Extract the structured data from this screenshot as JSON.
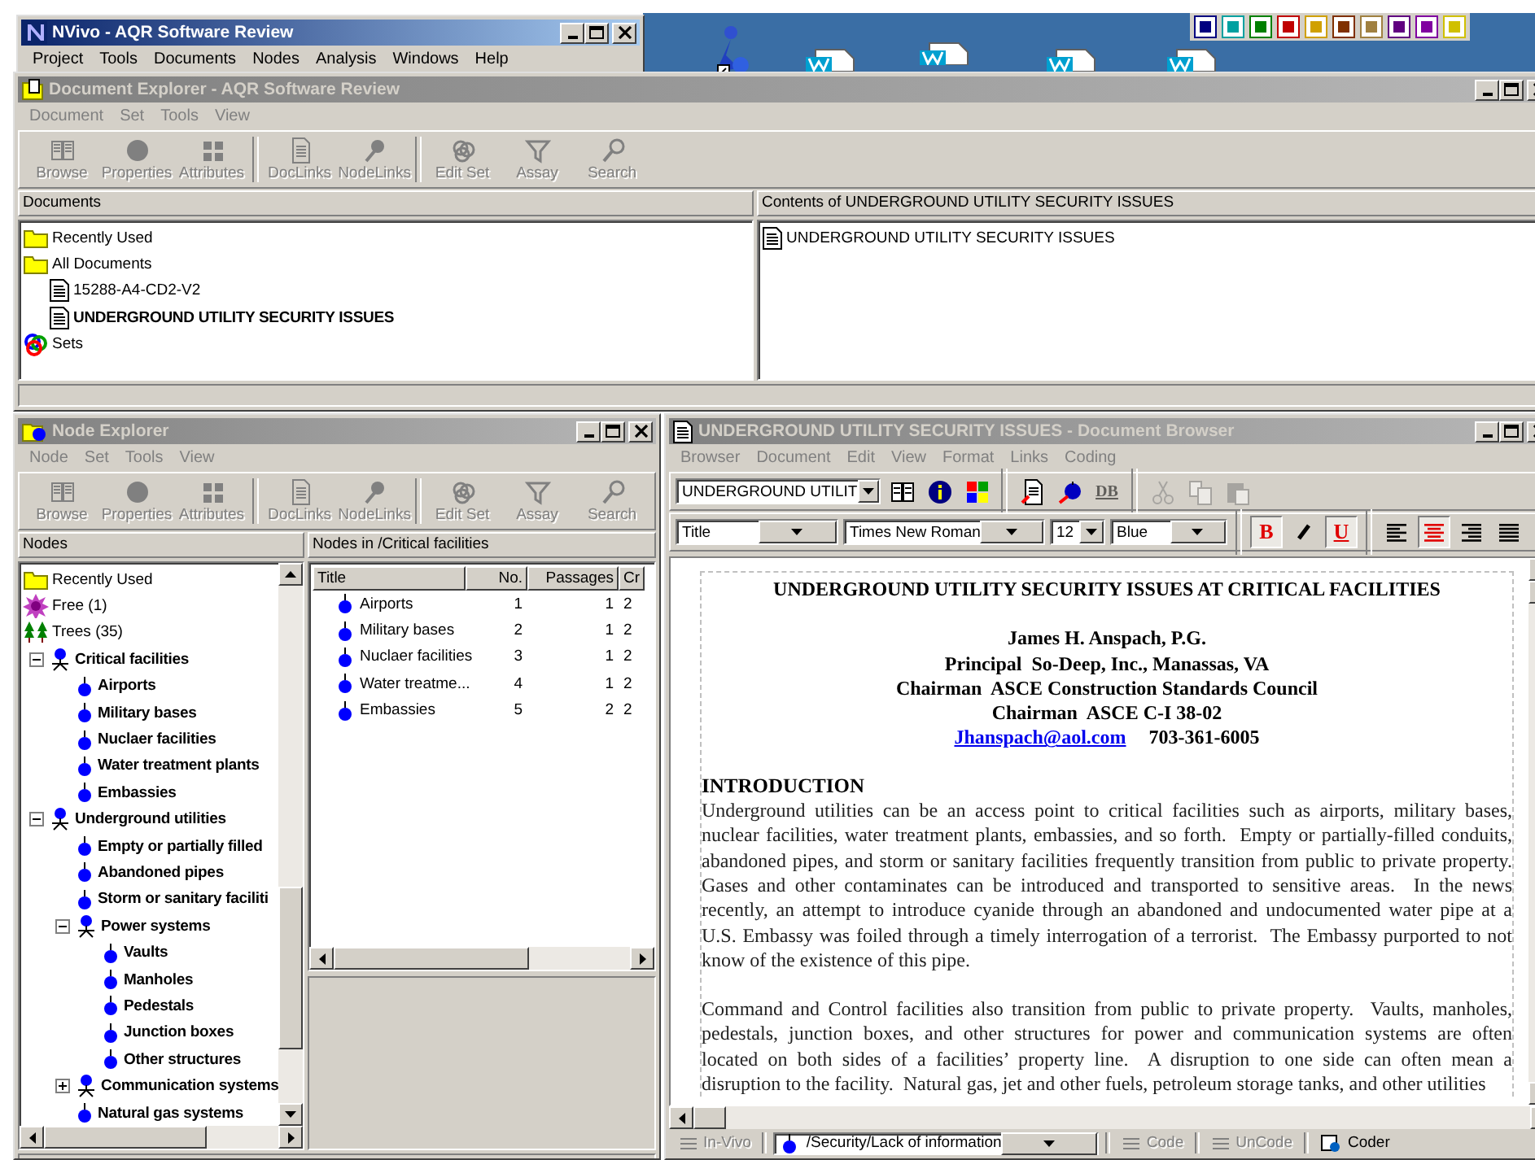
{
  "main_window": {
    "title": "NVivo - AQR Software Review",
    "active": true,
    "menu": [
      "Project",
      "Tools",
      "Documents",
      "Nodes",
      "Analysis",
      "Windows",
      "Help"
    ]
  },
  "document_explorer": {
    "title": "Document Explorer - AQR Software Review",
    "active": false,
    "menu": [
      "Document",
      "Set",
      "Tools",
      "View"
    ],
    "toolbar": [
      [
        {
          "label": "Browse",
          "kind": "book",
          "disabled": true
        },
        {
          "label": "Properties",
          "kind": "circle",
          "disabled": true
        },
        {
          "label": "Attributes",
          "kind": "grid",
          "disabled": true
        }
      ],
      [
        {
          "label": "DocLinks",
          "kind": "doclink",
          "disabled": true
        },
        {
          "label": "NodeLinks",
          "kind": "pin",
          "disabled": true
        }
      ],
      [
        {
          "label": "Edit Set",
          "kind": "sets",
          "disabled": true
        },
        {
          "label": "Assay",
          "kind": "funnel",
          "disabled": true
        },
        {
          "label": "Search",
          "kind": "search",
          "disabled": true
        }
      ]
    ],
    "documents_pane": {
      "header": "Documents",
      "items": [
        {
          "label": "Recently Used",
          "kind": "folder"
        },
        {
          "label": "All Documents",
          "kind": "folder",
          "children": [
            {
              "label": "15288-A4-CD2-V2",
              "kind": "document",
              "open": false
            },
            {
              "label": "UNDERGROUND UTILITY SECURITY ISSUES",
              "kind": "document",
              "open": true
            }
          ]
        },
        {
          "label": "Sets",
          "kind": "sets"
        }
      ]
    },
    "contents_pane": {
      "header": "Contents of UNDERGROUND UTILITY SECURITY ISSUES",
      "items": [
        {
          "label": "UNDERGROUND UTILITY SECURITY ISSUES",
          "kind": "document"
        }
      ]
    }
  },
  "node_explorer": {
    "title": "Node Explorer",
    "active": false,
    "menu": [
      "Node",
      "Set",
      "Tools",
      "View"
    ],
    "toolbar": [
      [
        {
          "label": "Browse",
          "kind": "book",
          "disabled": true
        },
        {
          "label": "Properties",
          "kind": "circle",
          "disabled": true
        },
        {
          "label": "Attributes",
          "kind": "grid",
          "disabled": true
        }
      ],
      [
        {
          "label": "DocLinks",
          "kind": "doclink",
          "disabled": true
        },
        {
          "label": "NodeLinks",
          "kind": "pin",
          "disabled": true
        }
      ],
      [
        {
          "label": "Edit Set",
          "kind": "sets",
          "disabled": true
        },
        {
          "label": "Assay",
          "kind": "funnel",
          "disabled": true
        },
        {
          "label": "Search",
          "kind": "search",
          "disabled": true
        }
      ]
    ],
    "nodes_pane": {
      "header": "Nodes",
      "items": [
        {
          "label": "Recently Used",
          "kind": "folder"
        },
        {
          "label": "Free (1)",
          "kind": "free"
        },
        {
          "label": "Trees (35)",
          "kind": "trees",
          "children": [
            {
              "label": "Critical facilities",
              "kind": "tree-node",
              "expanded": true,
              "children": [
                {
                  "label": "Airports",
                  "kind": "node"
                },
                {
                  "label": "Military bases",
                  "kind": "node"
                },
                {
                  "label": "Nuclaer facilities",
                  "kind": "node"
                },
                {
                  "label": "Water treatment plants",
                  "kind": "node"
                },
                {
                  "label": "Embassies",
                  "kind": "node"
                }
              ]
            },
            {
              "label": "Underground utilities",
              "kind": "tree-node",
              "expanded": true,
              "children": [
                {
                  "label": "Empty or partially filled",
                  "kind": "node"
                },
                {
                  "label": "Abandoned pipes",
                  "kind": "node"
                },
                {
                  "label": "Storm or sanitary faciliti",
                  "kind": "node"
                },
                {
                  "label": "Power systems",
                  "kind": "tree-node",
                  "expanded": true,
                  "children": [
                    {
                      "label": "Vaults",
                      "kind": "node"
                    },
                    {
                      "label": "Manholes",
                      "kind": "node"
                    },
                    {
                      "label": "Pedestals",
                      "kind": "node"
                    },
                    {
                      "label": "Junction boxes",
                      "kind": "node"
                    },
                    {
                      "label": "Other structures",
                      "kind": "node"
                    }
                  ]
                },
                {
                  "label": "Communication systems",
                  "kind": "tree-node",
                  "expanded": false
                },
                {
                  "label": "Natural gas systems",
                  "kind": "node"
                }
              ]
            }
          ]
        }
      ]
    },
    "list_pane": {
      "header": "Nodes in /Critical facilities",
      "columns": [
        "Title",
        "No.",
        "Passages",
        "Cr"
      ],
      "rows": [
        [
          "Airports",
          "1",
          "1",
          "2"
        ],
        [
          "Military bases",
          "2",
          "1",
          "2"
        ],
        [
          "Nuclaer facilities",
          "3",
          "1",
          "2"
        ],
        [
          "Water treatme...",
          "4",
          "1",
          "2"
        ],
        [
          "Embassies",
          "5",
          "2",
          "2"
        ]
      ]
    }
  },
  "document_browser": {
    "title": "UNDERGROUND UTILITY SECURITY ISSUES - Document Browser",
    "active": false,
    "menu": [
      "Browser",
      "Document",
      "Edit",
      "View",
      "Format",
      "Links",
      "Coding"
    ],
    "document_combo": "UNDERGROUND UTILIT",
    "tools": [
      {
        "kind": "book",
        "disabled": false
      },
      {
        "kind": "info",
        "disabled": false
      },
      {
        "kind": "palette",
        "disabled": false
      },
      {
        "kind": "doclink",
        "disabled": false
      },
      {
        "kind": "nodelink",
        "disabled": false
      },
      {
        "kind": "database",
        "label": "DB",
        "disabled": true
      },
      {
        "kind": "cut",
        "disabled": true
      },
      {
        "kind": "copy",
        "disabled": true
      },
      {
        "kind": "paste",
        "disabled": true
      }
    ],
    "format": {
      "style": "Title",
      "font": "Times New Roman",
      "size": "12",
      "text_colour": "Blue",
      "buttons": [
        {
          "kind": "bold",
          "label": "B",
          "pressed": true
        },
        {
          "kind": "italic",
          "pressed": false
        },
        {
          "kind": "underline",
          "label": "U",
          "pressed": true
        },
        {
          "kind": "align-left",
          "pressed": false
        },
        {
          "kind": "align-center",
          "pressed": true
        },
        {
          "kind": "align-right",
          "pressed": false
        },
        {
          "kind": "justify",
          "pressed": false
        }
      ]
    },
    "document": [
      {
        "kind": "title",
        "text": "UNDERGROUND UTILITY SECURITY ISSUES AT CRITICAL FACILITIES"
      },
      {
        "kind": "author",
        "lines": [
          "James H. Anspach, P.G.",
          "Principal  So-Deep, Inc., Manassas, VA",
          "Chairman  ASCE Construction Standards Council",
          "Chairman  ASCE C-I 38-02"
        ]
      },
      {
        "kind": "contact",
        "link": "Jhanspach@aol.com",
        "text": "703-361-6005"
      },
      {
        "kind": "heading",
        "text": "INTRODUCTION"
      },
      {
        "kind": "paragraph",
        "lines": [
          "Underground utilities can be an access point to critical facilities such as airports, military bases,",
          "nuclear facilities, water treatment plants, embassies, and so forth.  Empty or partially-filled conduits,",
          "abandoned pipes, and storm or sanitary facilities frequently transition from public to private property.",
          "Gases and other contaminates can be introduced and transported to sensitive areas.  In the news",
          "recently, an attempt to introduce cyanide through an abandoned and undocumented water pipe at a",
          "U.S. Embassy was foiled through a timely interrogation of a terrorist.  The Embassy purported to not",
          "know of the existence of this pipe."
        ]
      },
      {
        "kind": "paragraph",
        "lines": [
          "Command and Control facilities also transition from public to private property.  Vaults, manholes,",
          "pedestals, junction boxes, and other structures for power and communication systems are often",
          "located on both sides of a facilities’ property line.  A disruption to one side can often mean a",
          "disruption to the facility.  Natural gas, jet and other fuels, petroleum storage tanks, and other utilities"
        ]
      }
    ],
    "coding_bar": {
      "in_vivo": {
        "label": "In-Vivo",
        "disabled": true
      },
      "node": "/Security/Lack of information",
      "actions": [
        {
          "label": "Code",
          "kind": "code",
          "disabled": true
        },
        {
          "label": "UnCode",
          "kind": "code",
          "disabled": true
        },
        {
          "label": "Coder",
          "kind": "coder",
          "disabled": false
        }
      ]
    }
  }
}
